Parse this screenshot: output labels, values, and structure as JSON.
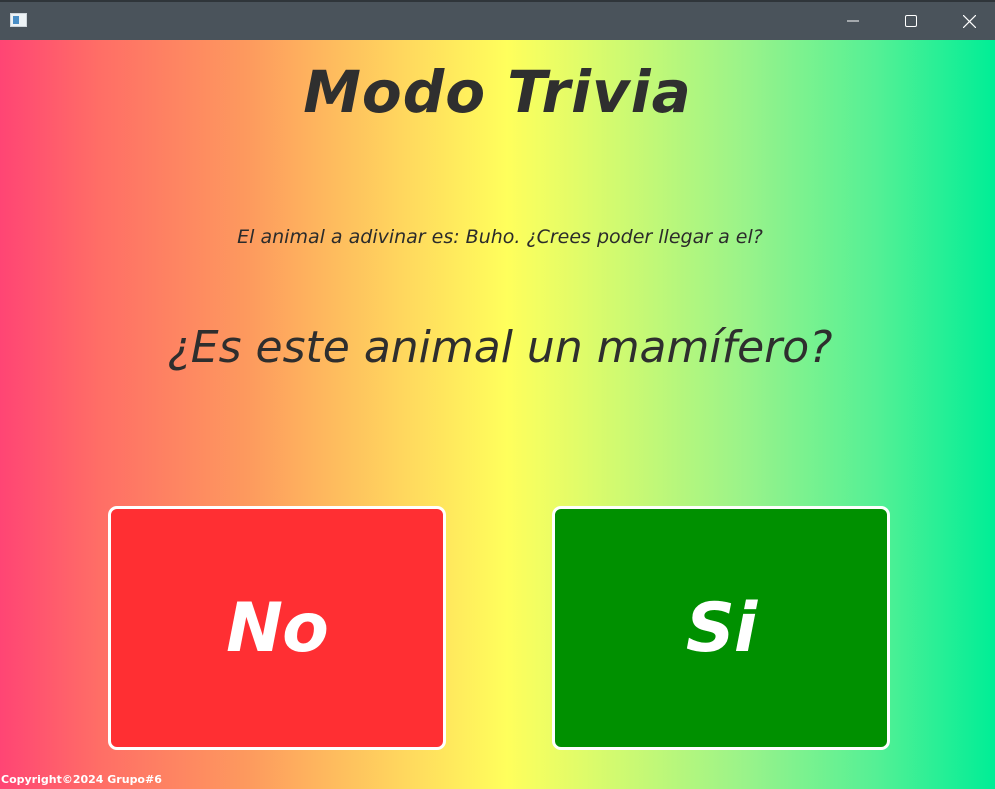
{
  "window": {
    "controls": {
      "minimize_icon": "minimize-icon",
      "maximize_icon": "maximize-icon",
      "close_icon": "close-icon"
    }
  },
  "main": {
    "title": "Modo Trivia",
    "intro": "El animal a adivinar es: Buho. ¿Crees poder llegar a el?",
    "question": "¿Es este animal un mamífero?"
  },
  "answers": {
    "no_label": "No",
    "si_label": "Si",
    "no_color": "#ff2f33",
    "si_color": "#009000"
  },
  "footer": {
    "copyright": "Copyright©2024 Grupo#6"
  },
  "colors": {
    "gradient_left": "#ff4574",
    "gradient_center": "#ffff5c",
    "gradient_right": "#00ee96",
    "titlebar": "#4a535b"
  }
}
